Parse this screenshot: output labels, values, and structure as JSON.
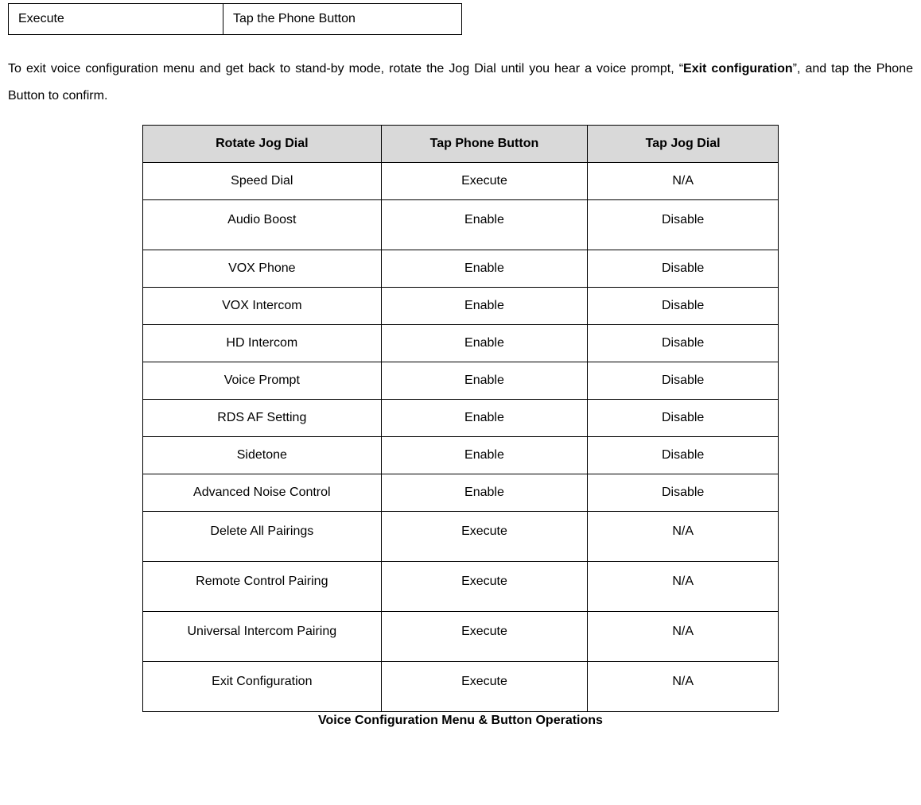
{
  "top_row": {
    "left": "Execute",
    "right": "Tap the Phone Button"
  },
  "paragraph": {
    "part1": "To exit voice configuration menu and get back to stand-by mode, rotate the Jog Dial until you hear a voice prompt, “",
    "bold": "Exit configuration",
    "part2": "”, and tap the Phone Button to confirm."
  },
  "main_table": {
    "headers": {
      "col1": "Rotate Jog Dial",
      "col2": "Tap Phone Button",
      "col3": "Tap Jog Dial"
    },
    "rows": [
      {
        "c1": "Speed Dial",
        "c2": "Execute",
        "c3": "N/A",
        "tall": false
      },
      {
        "c1": "Audio Boost",
        "c2": "Enable",
        "c3": "Disable",
        "tall": true
      },
      {
        "c1": "VOX Phone",
        "c2": "Enable",
        "c3": "Disable",
        "tall": false
      },
      {
        "c1": "VOX Intercom",
        "c2": "Enable",
        "c3": "Disable",
        "tall": false
      },
      {
        "c1": "HD Intercom",
        "c2": "Enable",
        "c3": "Disable",
        "tall": false
      },
      {
        "c1": "Voice Prompt",
        "c2": "Enable",
        "c3": "Disable",
        "tall": false
      },
      {
        "c1": "RDS AF Setting",
        "c2": "Enable",
        "c3": "Disable",
        "tall": false
      },
      {
        "c1": "Sidetone",
        "c2": "Enable",
        "c3": "Disable",
        "tall": false
      },
      {
        "c1": "Advanced Noise Control",
        "c2": "Enable",
        "c3": "Disable",
        "tall": false
      },
      {
        "c1": "Delete All Pairings",
        "c2": "Execute",
        "c3": "N/A",
        "tall": true
      },
      {
        "c1": "Remote Control Pairing",
        "c2": "Execute",
        "c3": "N/A",
        "tall": true
      },
      {
        "c1": "Universal Intercom Pairing",
        "c2": "Execute",
        "c3": "N/A",
        "tall": true
      },
      {
        "c1": "Exit Configuration",
        "c2": "Execute",
        "c3": "N/A",
        "tall": true
      }
    ]
  },
  "caption": "Voice Configuration Menu & Button Operations"
}
